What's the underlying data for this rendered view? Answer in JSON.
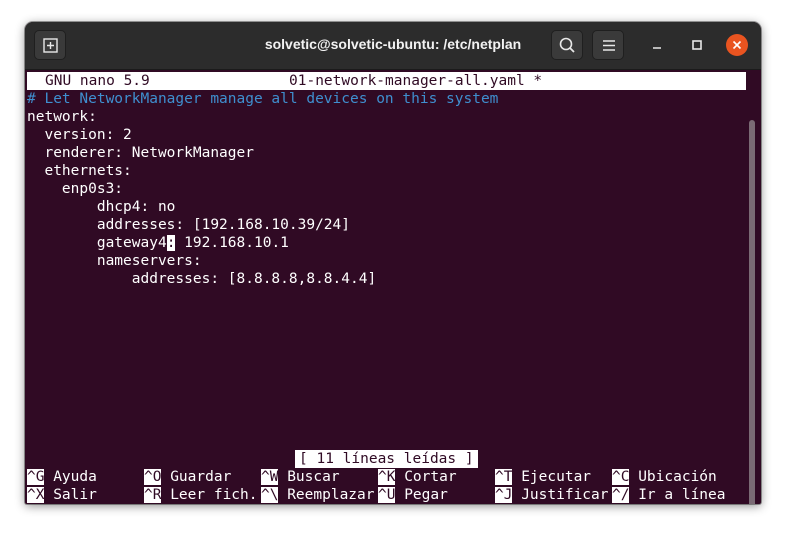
{
  "window": {
    "title": "solvetic@solvetic-ubuntu: /etc/netplan",
    "icons": {
      "new_tab": "new-tab-icon",
      "search": "search-icon",
      "menu": "hamburger-menu-icon",
      "minimize": "minimize-icon",
      "maximize": "maximize-icon",
      "close": "close-icon"
    },
    "colors": {
      "terminal_bg": "#300a24",
      "close_button": "#e95420",
      "comment": "#3f8fcf"
    }
  },
  "nano": {
    "version": "GNU nano 5.9",
    "filename": "01-network-manager-all.yaml *",
    "status_message": "[ 11 líneas leídas ]",
    "content": {
      "l1": "# Let NetworkManager manage all devices on this system",
      "l2": "network:",
      "l3": "  version: 2",
      "l4": "  renderer: NetworkManager",
      "l5": "  ethernets:",
      "l6": "    enp0s3:",
      "l7": "        dhcp4: no",
      "l8": "        addresses: [192.168.10.39/24]",
      "l9_pre": "        gateway4",
      "l9_cursor": ":",
      "l9_post": " 192.168.10.1",
      "l10": "        nameservers:",
      "l11": "            addresses: [8.8.8.8,8.8.4.4]"
    },
    "shortcuts_row1": [
      {
        "key": "^G",
        "label": "Ayuda"
      },
      {
        "key": "^O",
        "label": "Guardar"
      },
      {
        "key": "^W",
        "label": "Buscar"
      },
      {
        "key": "^K",
        "label": "Cortar"
      },
      {
        "key": "^T",
        "label": "Ejecutar"
      },
      {
        "key": "^C",
        "label": "Ubicación"
      }
    ],
    "shortcuts_row2": [
      {
        "key": "^X",
        "label": "Salir"
      },
      {
        "key": "^R",
        "label": "Leer fich."
      },
      {
        "key": "^\\",
        "label": "Reemplazar"
      },
      {
        "key": "^U",
        "label": "Pegar"
      },
      {
        "key": "^J",
        "label": "Justificar"
      },
      {
        "key": "^/",
        "label": "Ir a línea"
      }
    ]
  }
}
